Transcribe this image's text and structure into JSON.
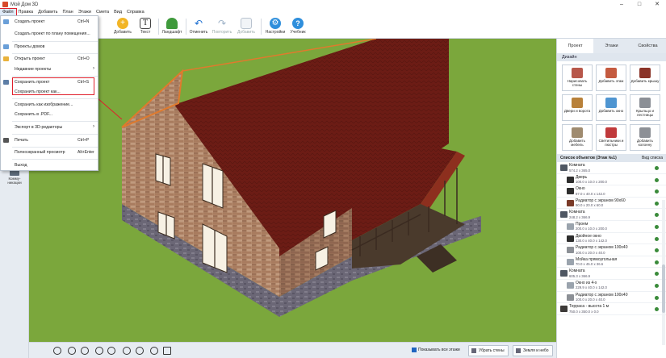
{
  "app": {
    "title": "Мой Дом 3D"
  },
  "window_controls": {
    "minimize": "–",
    "maximize": "□",
    "close": "✕"
  },
  "menu": [
    "Файл",
    "Правка",
    "Добавить",
    "План",
    "Этажи",
    "Смета",
    "Вид",
    "Справка"
  ],
  "toolbar": {
    "add": "Добавить",
    "text": "Текст",
    "landscape": "Ландшафт",
    "undo": "Отменить",
    "redo": "Повторить",
    "paste": "Добавить",
    "settings": "Настройки",
    "tutorial": "Учебник"
  },
  "file_menu": {
    "new_project": {
      "label": "Создать проект",
      "shortcut": "Ctrl+N"
    },
    "new_from_plan": {
      "label": "Создать проект по плану помещения..."
    },
    "house_projects": {
      "label": "Проекты домов"
    },
    "open_project": {
      "label": "Открыть проект",
      "shortcut": "Ctrl+O"
    },
    "recent": {
      "label": "Недавние проекты",
      "arrow": "›"
    },
    "save": {
      "label": "Сохранить проект",
      "shortcut": "Ctrl+S"
    },
    "save_as": {
      "label": "Сохранить проект как..."
    },
    "save_image": {
      "label": "Сохранить как изображение..."
    },
    "save_pdf": {
      "label": "Сохранить в .PDF..."
    },
    "export_3d": {
      "label": "Экспорт в 3D-редакторы",
      "arrow": "›"
    },
    "print": {
      "label": "Печать",
      "shortcut": "Ctrl+P"
    },
    "fullscreen": {
      "label": "Полноэкранный просмотр",
      "shortcut": "Alt+Enter"
    },
    "exit": {
      "label": "Выход"
    }
  },
  "left_tool": {
    "label": "Комму-\nникации"
  },
  "right_panel": {
    "tabs": [
      "Проект",
      "Этажи",
      "Свойства"
    ],
    "design_title": "Дизайн",
    "design_items": [
      {
        "label": "Нарисовать стены",
        "color": "#b7574a"
      },
      {
        "label": "Добавить этаж",
        "color": "#c45a3f"
      },
      {
        "label": "Добавить крышу",
        "color": "#8a3328"
      },
      {
        "label": "Двери и ворота",
        "color": "#b8813a"
      },
      {
        "label": "Добавить окно",
        "color": "#4f95d1"
      },
      {
        "label": "Крыльцо и лестницы",
        "color": "#8b8f96"
      },
      {
        "label": "Добавить мебель",
        "color": "#9f8b6f"
      },
      {
        "label": "Светильники и люстры",
        "color": "#c0393b"
      },
      {
        "label": "Добавить колонну",
        "color": "#8d9096"
      }
    ],
    "objects_title": "Список объектов (Этаж №1)",
    "view_list": "Вид списка",
    "objects": [
      {
        "kind": "room",
        "name": "Комната",
        "size": "574.2 x 365.0",
        "icon_color": "#4f5763"
      },
      {
        "kind": "child",
        "name": "Дверь",
        "size": "100.0 x 10.0 x 200.0",
        "icon_color": "#2d2d2d"
      },
      {
        "kind": "child",
        "name": "Окно",
        "size": "87.0 x 40.0 x 142.0",
        "icon_color": "#2d2d2d"
      },
      {
        "kind": "child",
        "name": "Радиатор с экраном 90x60",
        "size": "90.0 x 20.0 x 60.0",
        "icon_color": "#7a3a28"
      },
      {
        "kind": "room",
        "name": "Комната",
        "size": "248.2 x 366.9",
        "icon_color": "#4f5763"
      },
      {
        "kind": "child",
        "name": "Проем",
        "size": "200.0 x 10.0 x 200.0",
        "icon_color": "#9aa3ad"
      },
      {
        "kind": "child",
        "name": "Двойное окно",
        "size": "130.0 x 40.0 x 142.0",
        "icon_color": "#2d2d2d"
      },
      {
        "kind": "child",
        "name": "Радиатор с экраном 100x40",
        "size": "100.0 x 20.0 x 40.0",
        "icon_color": "#8c9096"
      },
      {
        "kind": "child",
        "name": "Мойка прямоугольная",
        "size": "70.0 x 45.0 x 36.6",
        "icon_color": "#9aa3ad"
      },
      {
        "kind": "room",
        "name": "Комната",
        "size": "605.3 x 366.9",
        "icon_color": "#4f5763"
      },
      {
        "kind": "child",
        "name": "Окно из 4-х",
        "size": "229.9 x 40.0 x 142.0",
        "icon_color": "#9aa3ad"
      },
      {
        "kind": "child",
        "name": "Радиатор с экраном 100x40",
        "size": "100.0 x 20.0 x 40.0",
        "icon_color": "#8c9096"
      },
      {
        "kind": "room",
        "name": "Терраса - высота 1 м",
        "size": "750.0 x 350.0 x 0.0",
        "icon_color": "#3c3a38"
      }
    ]
  },
  "bottom": {
    "show_all_floors": "Показывать все этажи",
    "hide_walls": "Убрать стены",
    "ground_sky": "Земля и небо"
  },
  "colors": {
    "accent_red": "#e0202c",
    "grass": "#7aa83a",
    "roof": "#6f1d16",
    "brick": "#b3876a"
  }
}
